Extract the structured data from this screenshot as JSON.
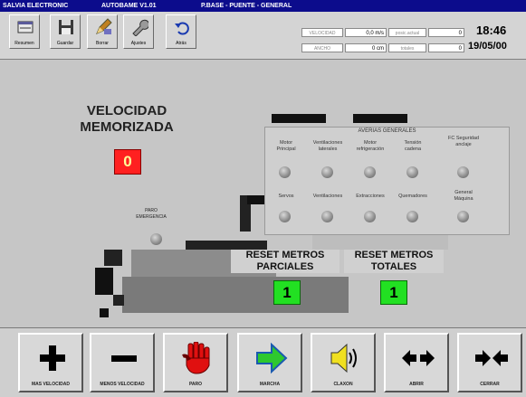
{
  "titlebar": {
    "app": "SALVIA ELECTRONIC",
    "program": "AUTOBAME V1.01",
    "screen": "P.BASE - PUENTE - GENERAL"
  },
  "toolbar": {
    "buttons": [
      {
        "label": "Resumen",
        "icon": "window-icon"
      },
      {
        "label": "Guardar",
        "icon": "save-icon"
      },
      {
        "label": "Borrar",
        "icon": "pencil-icon"
      },
      {
        "label": "Ajustes",
        "icon": "wrench-icon"
      },
      {
        "label": "Atrás",
        "icon": "undo-icon"
      }
    ],
    "fields": {
      "velocidad_label": "VELOCIDAD",
      "velocidad_value": "0,0 m/s",
      "ancho_label": "ANCHO",
      "ancho_value": "0 cm",
      "posicion_label": "posic.actual",
      "posicion_value": "0",
      "totales_label": "totales",
      "totales_value": "0"
    },
    "time": "18:46",
    "date": "19/05/00"
  },
  "main": {
    "velocidad_title_1": "VELOCIDAD",
    "velocidad_title_2": "MEMORIZADA",
    "velocidad_value": "0",
    "paro_label_1": "PARO",
    "paro_label_2": "EMERGENCIA",
    "averias_title": "AVERIAS GENERALES",
    "alarms_row1": [
      {
        "l1": "Motor",
        "l2": "Principal"
      },
      {
        "l1": "Ventilaciones",
        "l2": "laterales"
      },
      {
        "l1": "Motor",
        "l2": "refrigeración"
      },
      {
        "l1": "Tensión",
        "l2": "cadena"
      },
      {
        "l1": "FC Seguridad",
        "l2": "anclaje"
      }
    ],
    "alarms_row2": [
      {
        "l1": "Servos",
        "l2": ""
      },
      {
        "l1": "Ventilaciones",
        "l2": ""
      },
      {
        "l1": "Extracciones",
        "l2": ""
      },
      {
        "l1": "Quemadores",
        "l2": ""
      },
      {
        "l1": "General",
        "l2": "Máquina"
      }
    ],
    "reset_parciales_1": "RESET METROS",
    "reset_parciales_2": "PARCIALES",
    "reset_parciales_value": "1",
    "reset_totales_1": "RESET METROS",
    "reset_totales_2": "TOTALES",
    "reset_totales_value": "1"
  },
  "bottom": {
    "buttons": [
      {
        "label": "MAS VELOCIDAD",
        "icon": "plus-icon"
      },
      {
        "label": "MENOS VELOCIDAD",
        "icon": "minus-icon"
      },
      {
        "label": "PARO",
        "icon": "stop-hand-icon"
      },
      {
        "label": "MARCHA",
        "icon": "arrow-right-icon"
      },
      {
        "label": "CLAXON",
        "icon": "speaker-icon"
      },
      {
        "label": "ABRIR",
        "icon": "arrows-apart-icon"
      },
      {
        "label": "CERRAR",
        "icon": "arrows-together-icon"
      }
    ]
  },
  "colors": {
    "titlebar": "#0c0c8c",
    "alarm_red": "#ff2020",
    "ok_green": "#22e022",
    "stop_red": "#e01010",
    "march_green": "#2ec82e",
    "speaker_yellow": "#f0e020"
  }
}
